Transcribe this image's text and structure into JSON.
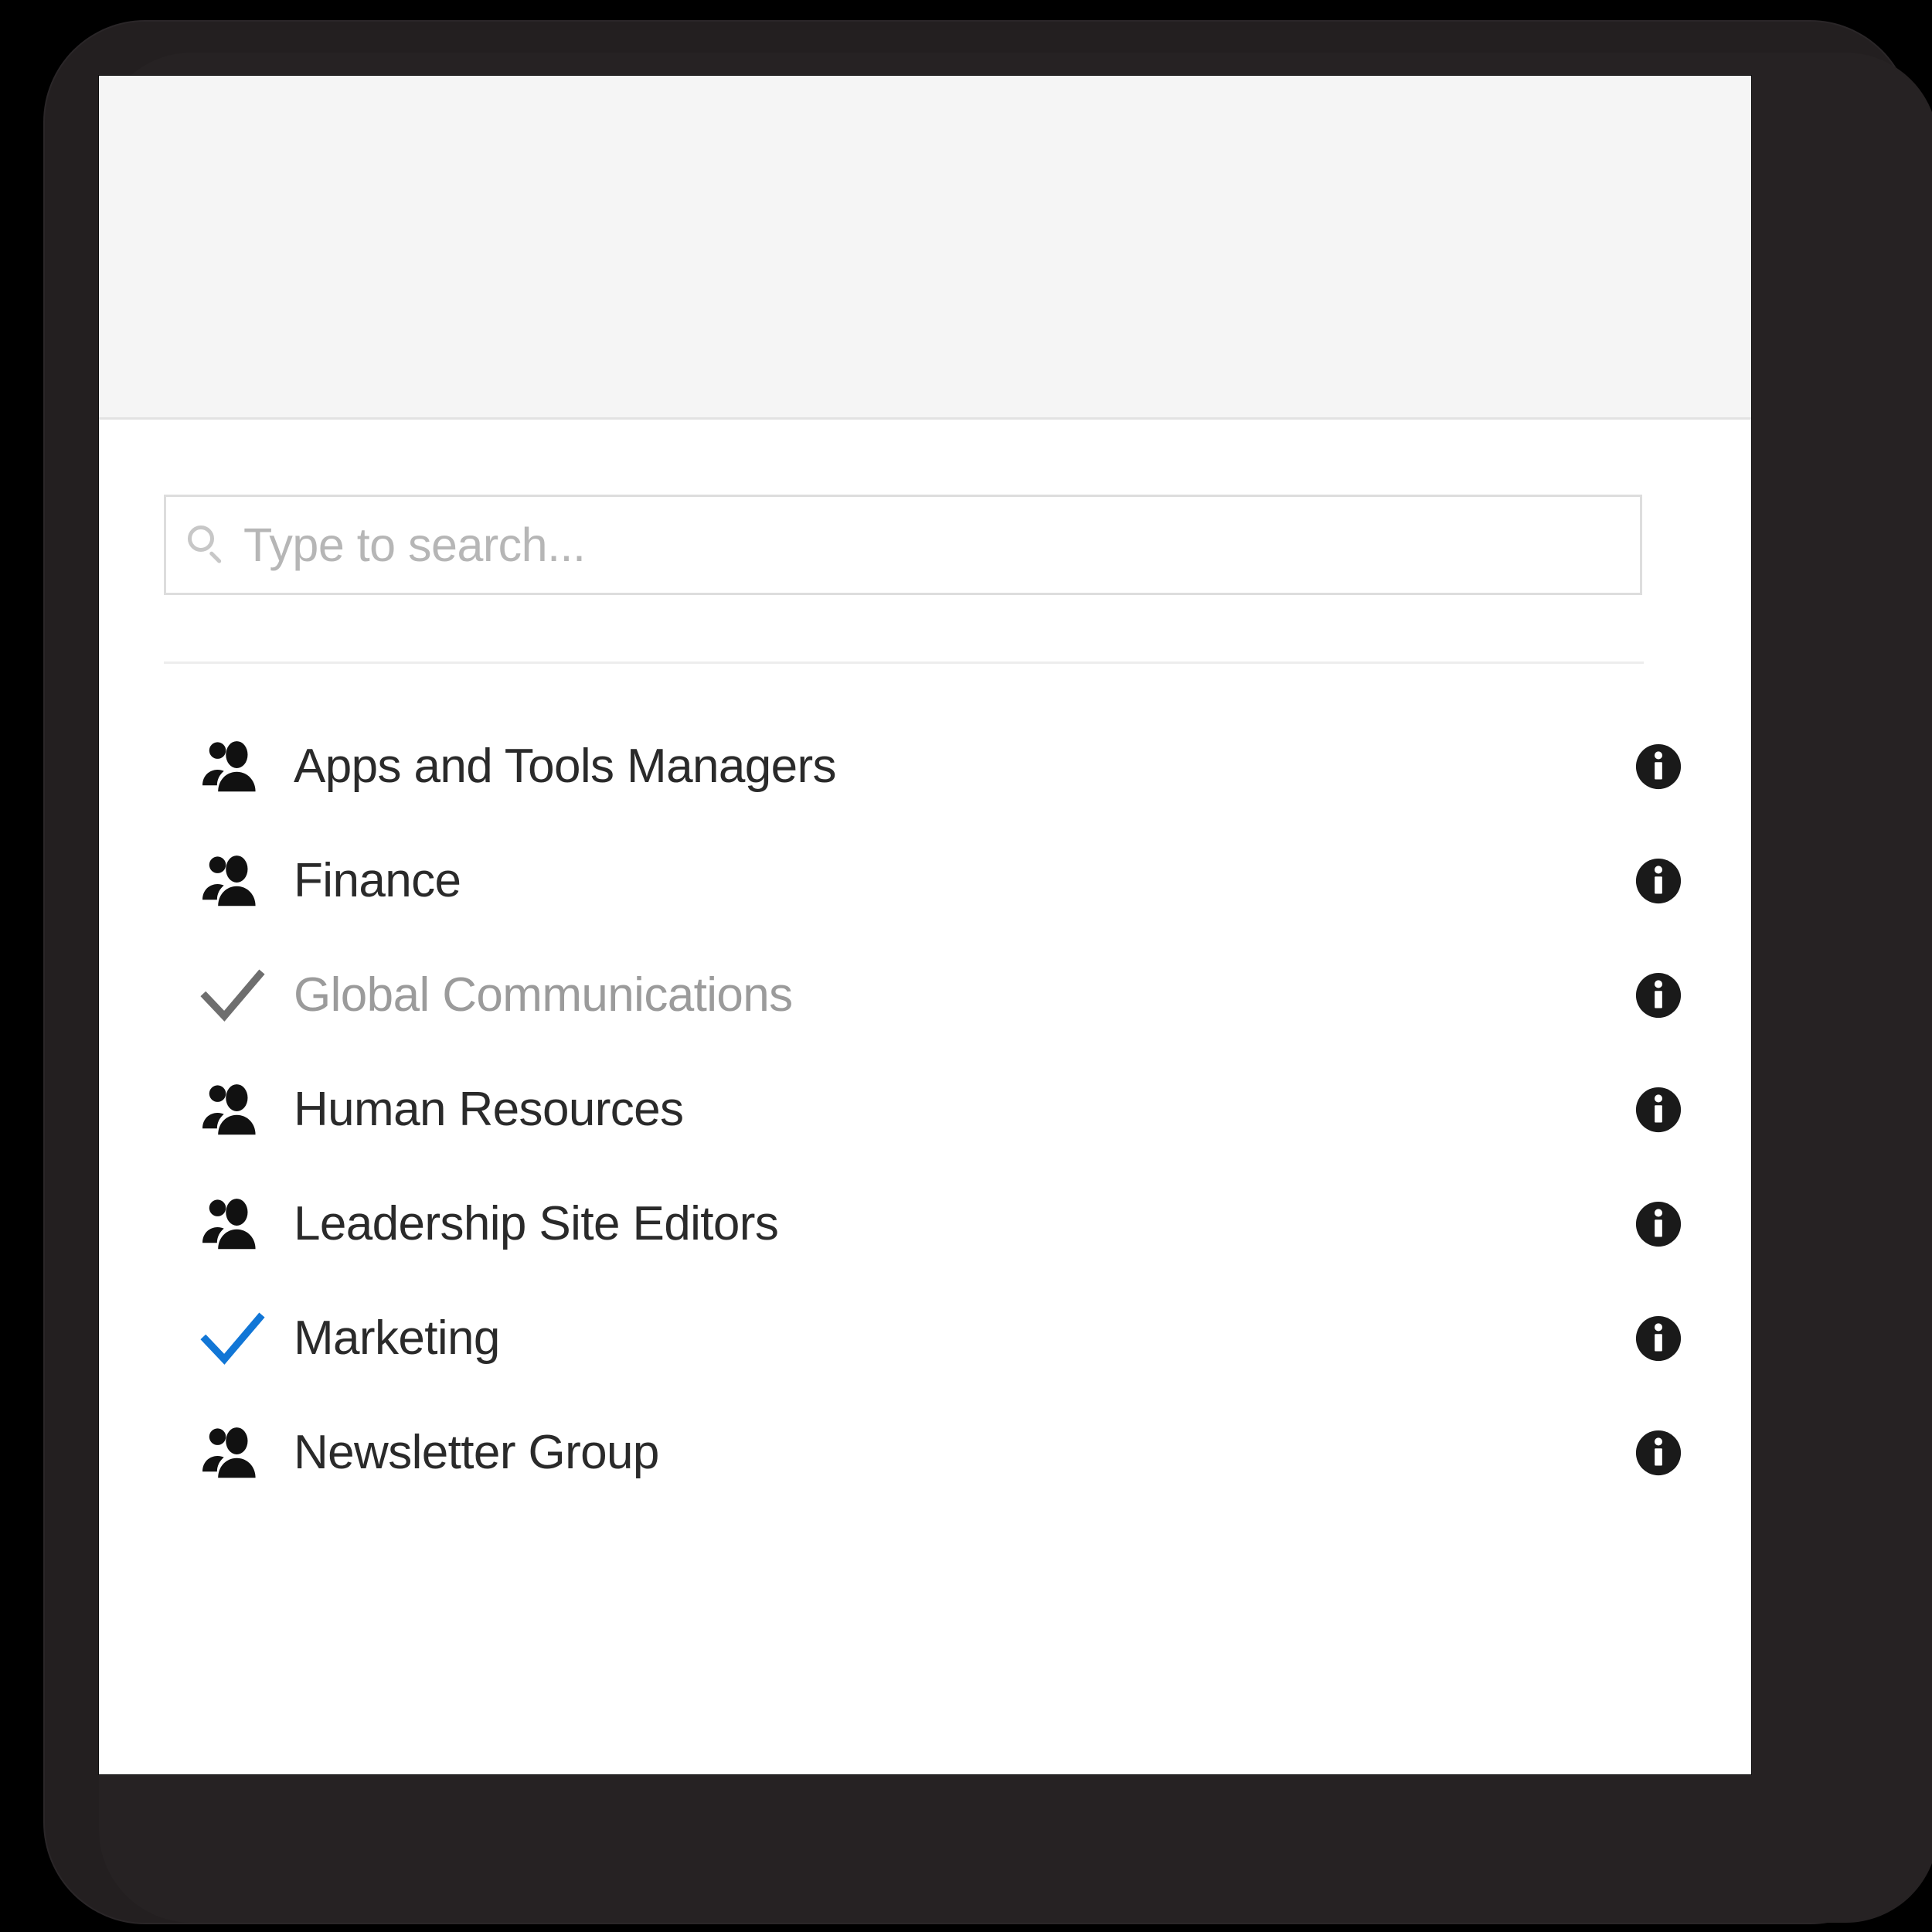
{
  "window": {
    "frame_color": "#231f20",
    "panel_background": "#ffffff",
    "header_background": "#f5f5f5",
    "header_title": ""
  },
  "search": {
    "placeholder": "Type to search...",
    "value": "",
    "icon": "search-icon"
  },
  "colors": {
    "accent_check": "#1176d6",
    "muted_check": "#6e6e6e",
    "muted_text": "#9b9b9b",
    "text": "#2a2a2a",
    "info_icon": "#1a1a1a",
    "border": "#dddddd",
    "divider": "#ededed"
  },
  "list": {
    "info_icon_name": "info-icon",
    "items": [
      {
        "label": "Apps and Tools Managers",
        "leading_icon": "people-group-icon",
        "state": "unselected",
        "info_label": "info"
      },
      {
        "label": "Finance",
        "leading_icon": "people-group-icon",
        "state": "unselected",
        "info_label": "info"
      },
      {
        "label": "Global Communications",
        "leading_icon": "check-icon",
        "state": "already-added",
        "info_label": "info"
      },
      {
        "label": "Human Resources",
        "leading_icon": "people-group-icon",
        "state": "unselected",
        "info_label": "info"
      },
      {
        "label": "Leadership Site Editors",
        "leading_icon": "people-group-icon",
        "state": "unselected",
        "info_label": "info"
      },
      {
        "label": "Marketing",
        "leading_icon": "check-icon",
        "state": "selected",
        "info_label": "info"
      },
      {
        "label": "Newsletter Group",
        "leading_icon": "people-group-icon",
        "state": "unselected",
        "info_label": "info"
      }
    ]
  }
}
